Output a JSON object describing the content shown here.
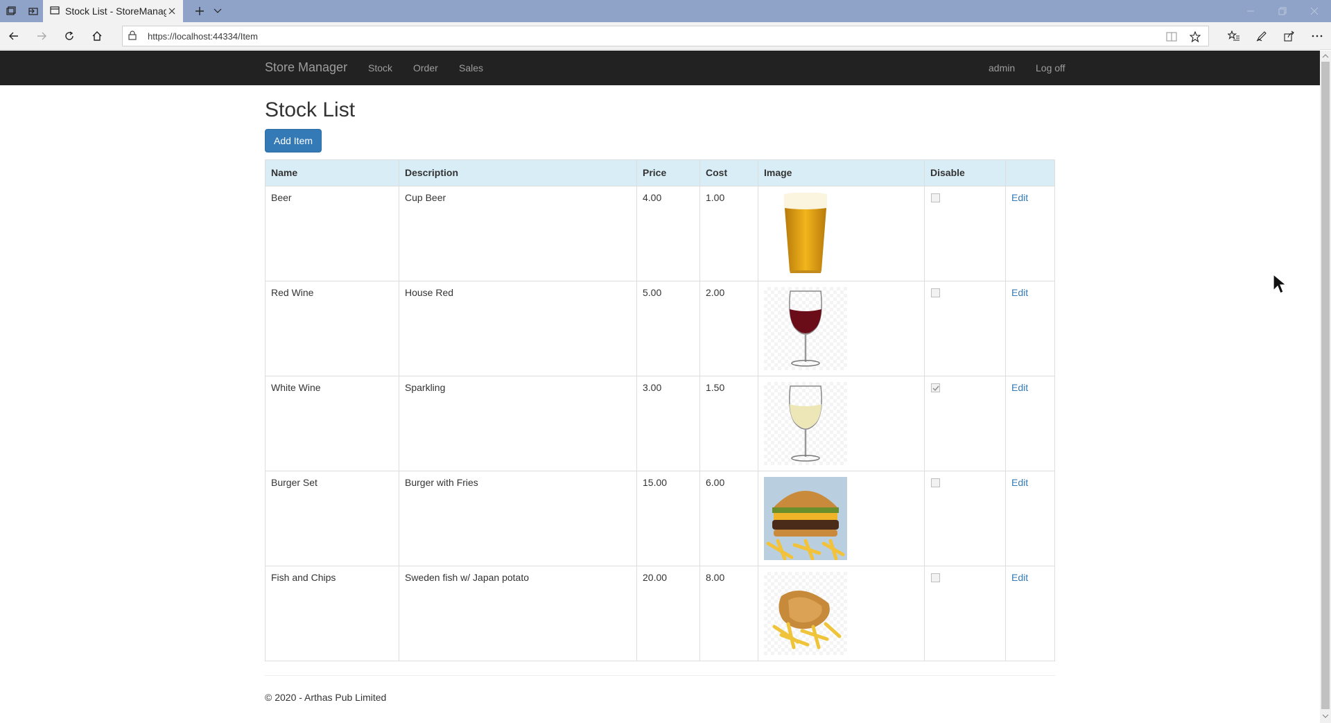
{
  "browser": {
    "tab_title": "Stock List - StoreManag",
    "url": "https://localhost:44334/Item"
  },
  "navbar": {
    "brand": "Store Manager",
    "links": [
      "Stock",
      "Order",
      "Sales"
    ],
    "user": "admin",
    "logoff": "Log off"
  },
  "page": {
    "title": "Stock List",
    "add_button": "Add Item"
  },
  "table": {
    "headers": [
      "Name",
      "Description",
      "Price",
      "Cost",
      "Image",
      "Disable",
      ""
    ],
    "rows": [
      {
        "name": "Beer",
        "description": "Cup Beer",
        "price": "4.00",
        "cost": "1.00",
        "image": "beer-glass",
        "disabled": false,
        "action": "Edit"
      },
      {
        "name": "Red Wine",
        "description": "House Red",
        "price": "5.00",
        "cost": "2.00",
        "image": "red-wine-glass",
        "disabled": false,
        "action": "Edit"
      },
      {
        "name": "White Wine",
        "description": "Sparkling",
        "price": "3.00",
        "cost": "1.50",
        "image": "white-wine-glass",
        "disabled": true,
        "action": "Edit"
      },
      {
        "name": "Burger Set",
        "description": "Burger with Fries",
        "price": "15.00",
        "cost": "6.00",
        "image": "burger-with-fries",
        "disabled": false,
        "action": "Edit"
      },
      {
        "name": "Fish and Chips",
        "description": "Sweden fish w/ Japan potato",
        "price": "20.00",
        "cost": "8.00",
        "image": "fish-and-chips",
        "disabled": false,
        "action": "Edit"
      }
    ]
  },
  "footer": {
    "text": "© 2020 - Arthas Pub Limited"
  },
  "colors": {
    "navbar_bg": "#222222",
    "primary": "#337ab7",
    "table_header_bg": "#d9edf7",
    "tab_strip": "#8fa3c8"
  }
}
